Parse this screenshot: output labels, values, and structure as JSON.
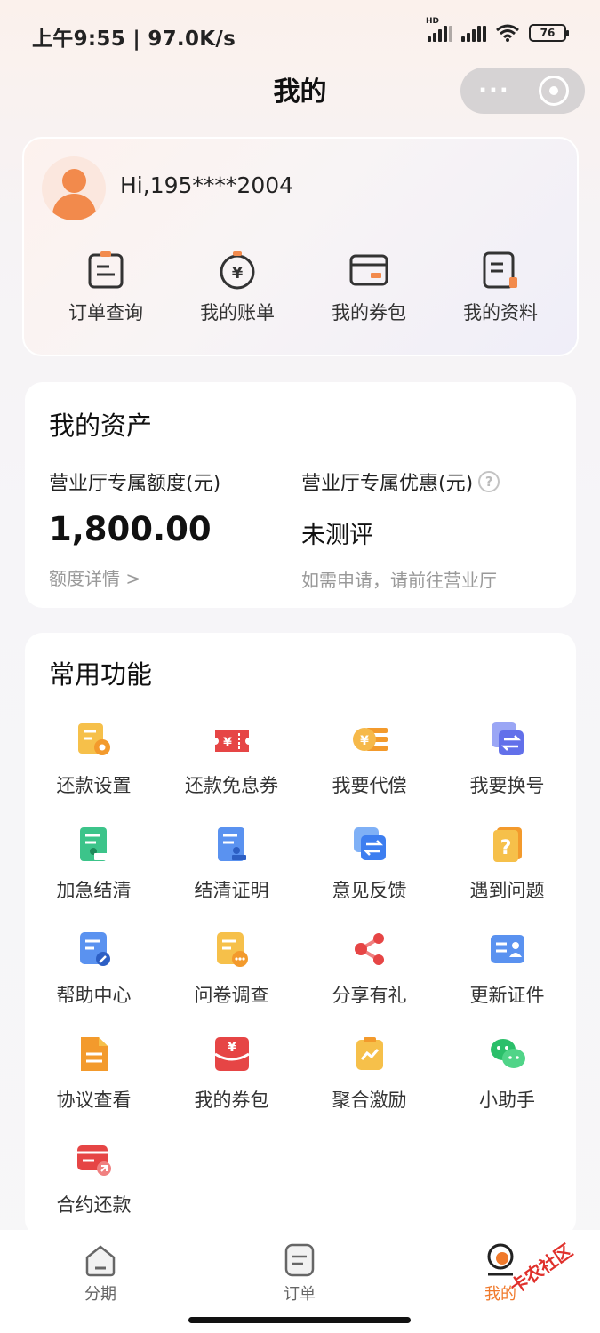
{
  "status_bar": {
    "time": "上午9:55 | 97.0K/s",
    "battery": "76",
    "network_badge": "HD"
  },
  "header": {
    "title": "我的",
    "more_glyph": "···"
  },
  "profile": {
    "greeting": "Hi,195****2004",
    "quick_actions": [
      {
        "label": "订单查询",
        "icon": "order-icon"
      },
      {
        "label": "我的账单",
        "icon": "bill-icon"
      },
      {
        "label": "我的券包",
        "icon": "coupon-card-icon"
      },
      {
        "label": "我的资料",
        "icon": "profile-doc-icon"
      }
    ]
  },
  "assets": {
    "title": "我的资产",
    "quota_label": "营业厅专属额度(元)",
    "quota_value": "1,800.00",
    "quota_link": "额度详情 >",
    "discount_label": "营业厅专属优惠(元)",
    "discount_help": "?",
    "discount_value": "未测评",
    "discount_hint": "如需申请，请前往营业厅"
  },
  "functions": {
    "title": "常用功能",
    "items": [
      {
        "label": "还款设置",
        "icon": "repayment-settings-icon"
      },
      {
        "label": "还款免息券",
        "icon": "interest-free-coupon-icon"
      },
      {
        "label": "我要代偿",
        "icon": "compensation-icon"
      },
      {
        "label": "我要换号",
        "icon": "change-number-icon"
      },
      {
        "label": "加急结清",
        "icon": "urgent-settlement-icon"
      },
      {
        "label": "结清证明",
        "icon": "settlement-proof-icon"
      },
      {
        "label": "意见反馈",
        "icon": "feedback-icon"
      },
      {
        "label": "遇到问题",
        "icon": "question-icon"
      },
      {
        "label": "帮助中心",
        "icon": "help-center-icon"
      },
      {
        "label": "问卷调查",
        "icon": "survey-icon"
      },
      {
        "label": "分享有礼",
        "icon": "share-icon"
      },
      {
        "label": "更新证件",
        "icon": "id-card-icon"
      },
      {
        "label": "协议查看",
        "icon": "agreement-icon"
      },
      {
        "label": "我的券包",
        "icon": "coupon-pack-icon"
      },
      {
        "label": "聚合激励",
        "icon": "incentive-icon"
      },
      {
        "label": "小助手",
        "icon": "wechat-assistant-icon"
      },
      {
        "label": "合约还款",
        "icon": "contract-repayment-icon"
      }
    ]
  },
  "tabbar": {
    "tabs": [
      {
        "label": "分期",
        "icon": "installment-home-icon"
      },
      {
        "label": "订单",
        "icon": "order-tab-icon"
      },
      {
        "label": "我的",
        "icon": "mine-tab-icon",
        "active": true
      }
    ]
  },
  "watermark": "卡农社区",
  "colors": {
    "accent": "#f07a2c",
    "card_bg": "#ffffff",
    "muted_text": "#999999"
  }
}
